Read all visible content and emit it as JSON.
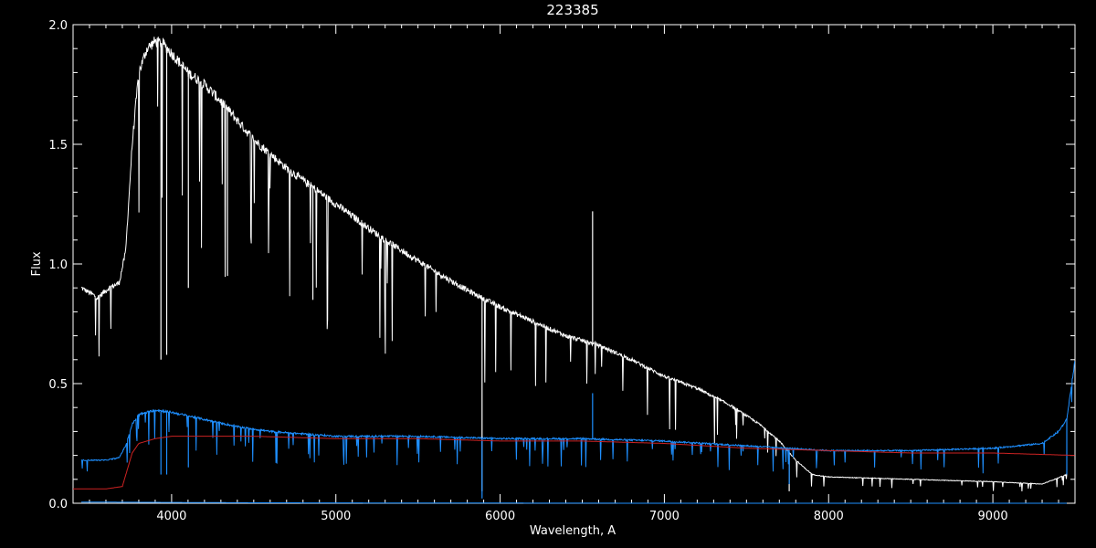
{
  "chart_data": {
    "type": "line",
    "title": "223385",
    "xlabel": "Wavelength, A",
    "ylabel": "Flux",
    "xlim": [
      3400,
      9500
    ],
    "ylim": [
      0.0,
      2.0
    ],
    "xticks": [
      4000,
      5000,
      6000,
      7000,
      8000,
      9000
    ],
    "yticks": [
      0.0,
      0.5,
      1.0,
      1.5,
      2.0
    ],
    "ytick_labels": [
      "0.0",
      "0.5",
      "1.0",
      "1.5",
      "2.0"
    ],
    "grid": false,
    "series": [
      {
        "color": "#ffffff",
        "points": [
          [
            3450,
            0.9
          ],
          [
            3550,
            0.86
          ],
          [
            3620,
            0.9
          ],
          [
            3680,
            0.92
          ],
          [
            3720,
            1.05
          ],
          [
            3760,
            1.5
          ],
          [
            3800,
            1.8
          ],
          [
            3850,
            1.9
          ],
          [
            3900,
            1.93
          ],
          [
            3950,
            1.92
          ],
          [
            4000,
            1.88
          ],
          [
            4100,
            1.8
          ],
          [
            4200,
            1.75
          ],
          [
            4300,
            1.68
          ],
          [
            4400,
            1.6
          ],
          [
            4500,
            1.52
          ],
          [
            4700,
            1.4
          ],
          [
            5000,
            1.25
          ],
          [
            5300,
            1.1
          ],
          [
            5600,
            0.97
          ],
          [
            5800,
            0.89
          ],
          [
            6000,
            0.82
          ],
          [
            6200,
            0.76
          ],
          [
            6400,
            0.7
          ],
          [
            6600,
            0.66
          ],
          [
            6800,
            0.6
          ],
          [
            7000,
            0.53
          ],
          [
            7200,
            0.48
          ],
          [
            7400,
            0.41
          ],
          [
            7580,
            0.33
          ],
          [
            7700,
            0.26
          ],
          [
            7800,
            0.18
          ],
          [
            7900,
            0.12
          ],
          [
            8000,
            0.11
          ],
          [
            8500,
            0.1
          ],
          [
            9000,
            0.09
          ],
          [
            9300,
            0.08
          ],
          [
            9450,
            0.12
          ]
        ],
        "features": [
          [
            3935,
            0.6
          ],
          [
            3970,
            0.62
          ],
          [
            4102,
            0.9
          ],
          [
            4340,
            0.95
          ],
          [
            4860,
            0.85
          ],
          [
            5890,
            0.05
          ],
          [
            6563,
            1.22
          ],
          [
            7760,
            0.05
          ]
        ]
      },
      {
        "color": "#1e8fff",
        "points": [
          [
            3450,
            0.18
          ],
          [
            3600,
            0.18
          ],
          [
            3680,
            0.19
          ],
          [
            3720,
            0.24
          ],
          [
            3760,
            0.33
          ],
          [
            3800,
            0.37
          ],
          [
            3900,
            0.39
          ],
          [
            4000,
            0.38
          ],
          [
            4200,
            0.35
          ],
          [
            4400,
            0.32
          ],
          [
            4600,
            0.3
          ],
          [
            5000,
            0.28
          ],
          [
            5500,
            0.28
          ],
          [
            6000,
            0.27
          ],
          [
            6500,
            0.27
          ],
          [
            7000,
            0.26
          ],
          [
            7500,
            0.24
          ],
          [
            8000,
            0.22
          ],
          [
            8500,
            0.22
          ],
          [
            9000,
            0.23
          ],
          [
            9300,
            0.25
          ],
          [
            9400,
            0.3
          ],
          [
            9450,
            0.35
          ],
          [
            9500,
            0.6
          ]
        ],
        "features": [
          [
            3935,
            0.12
          ],
          [
            3970,
            0.12
          ],
          [
            4102,
            0.15
          ],
          [
            5890,
            0.02
          ],
          [
            6563,
            0.46
          ],
          [
            7760,
            0.08
          ],
          [
            9450,
            0.12
          ]
        ]
      },
      {
        "color": "#cc2222",
        "points": [
          [
            3400,
            0.06
          ],
          [
            3600,
            0.06
          ],
          [
            3700,
            0.07
          ],
          [
            3760,
            0.21
          ],
          [
            3800,
            0.25
          ],
          [
            3900,
            0.27
          ],
          [
            4000,
            0.28
          ],
          [
            4500,
            0.28
          ],
          [
            5000,
            0.27
          ],
          [
            5500,
            0.27
          ],
          [
            6000,
            0.26
          ],
          [
            6500,
            0.26
          ],
          [
            7000,
            0.25
          ],
          [
            7500,
            0.23
          ],
          [
            8000,
            0.22
          ],
          [
            8500,
            0.21
          ],
          [
            9000,
            0.21
          ],
          [
            9500,
            0.2
          ]
        ]
      },
      {
        "color": "#1e8fff",
        "points": [
          [
            3450,
            0.005
          ],
          [
            4500,
            0.002
          ],
          [
            5500,
            0.001
          ],
          [
            7000,
            0.0
          ],
          [
            9450,
            0.0
          ]
        ]
      }
    ]
  }
}
